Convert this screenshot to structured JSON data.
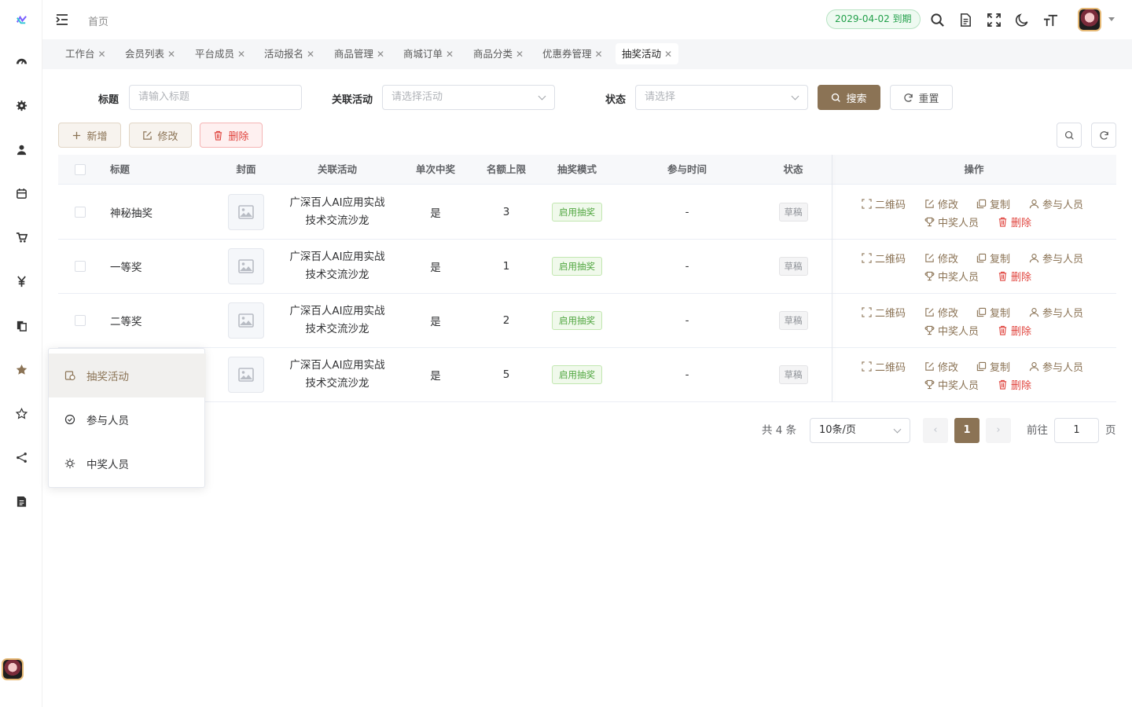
{
  "header": {
    "breadcrumb": "首页",
    "expiry": "2029-04-02 到期"
  },
  "tabs": [
    {
      "label": "工作台"
    },
    {
      "label": "会员列表"
    },
    {
      "label": "平台成员"
    },
    {
      "label": "活动报名"
    },
    {
      "label": "商品管理"
    },
    {
      "label": "商城订单"
    },
    {
      "label": "商品分类"
    },
    {
      "label": "优惠券管理"
    },
    {
      "label": "抽奖活动"
    }
  ],
  "search": {
    "title_label": "标题",
    "title_placeholder": "请输入标题",
    "activity_label": "关联活动",
    "activity_placeholder": "请选择活动",
    "status_label": "状态",
    "status_placeholder": "请选择",
    "search_btn": "搜索",
    "reset_btn": "重置"
  },
  "toolbar": {
    "add": "新增",
    "edit": "修改",
    "delete": "删除"
  },
  "table": {
    "columns": [
      "标题",
      "封面",
      "关联活动",
      "单次中奖",
      "名额上限",
      "抽奖模式",
      "参与时间",
      "状态",
      "操作"
    ],
    "rows": [
      {
        "title": "神秘抽奖",
        "activity_line1": "广深百人AI应用实战",
        "activity_line2": "技术交流沙龙",
        "single": "是",
        "limit": "3",
        "mode": "启用抽奖",
        "time": "-",
        "status": "草稿"
      },
      {
        "title": "一等奖",
        "activity_line1": "广深百人AI应用实战",
        "activity_line2": "技术交流沙龙",
        "single": "是",
        "limit": "1",
        "mode": "启用抽奖",
        "time": "-",
        "status": "草稿"
      },
      {
        "title": "二等奖",
        "activity_line1": "广深百人AI应用实战",
        "activity_line2": "技术交流沙龙",
        "single": "是",
        "limit": "2",
        "mode": "启用抽奖",
        "time": "-",
        "status": "草稿"
      },
      {
        "title": "",
        "activity_line1": "广深百人AI应用实战",
        "activity_line2": "技术交流沙龙",
        "single": "是",
        "limit": "5",
        "mode": "启用抽奖",
        "time": "-",
        "status": "草稿"
      }
    ],
    "actions": {
      "qrcode": "二维码",
      "edit": "修改",
      "copy": "复制",
      "participants": "参与人员",
      "winners": "中奖人员",
      "delete": "删除"
    }
  },
  "pagination": {
    "total": "共 4 条",
    "page_size": "10条/页",
    "current": "1",
    "goto_label": "前往",
    "goto_value": "1",
    "page_suffix": "页"
  },
  "submenu": {
    "items": [
      {
        "label": "抽奖活动"
      },
      {
        "label": "参与人员"
      },
      {
        "label": "中奖人员"
      }
    ]
  },
  "colors": {
    "primary": "#8b7355",
    "danger": "#e0443e",
    "success": "#23a04b"
  }
}
